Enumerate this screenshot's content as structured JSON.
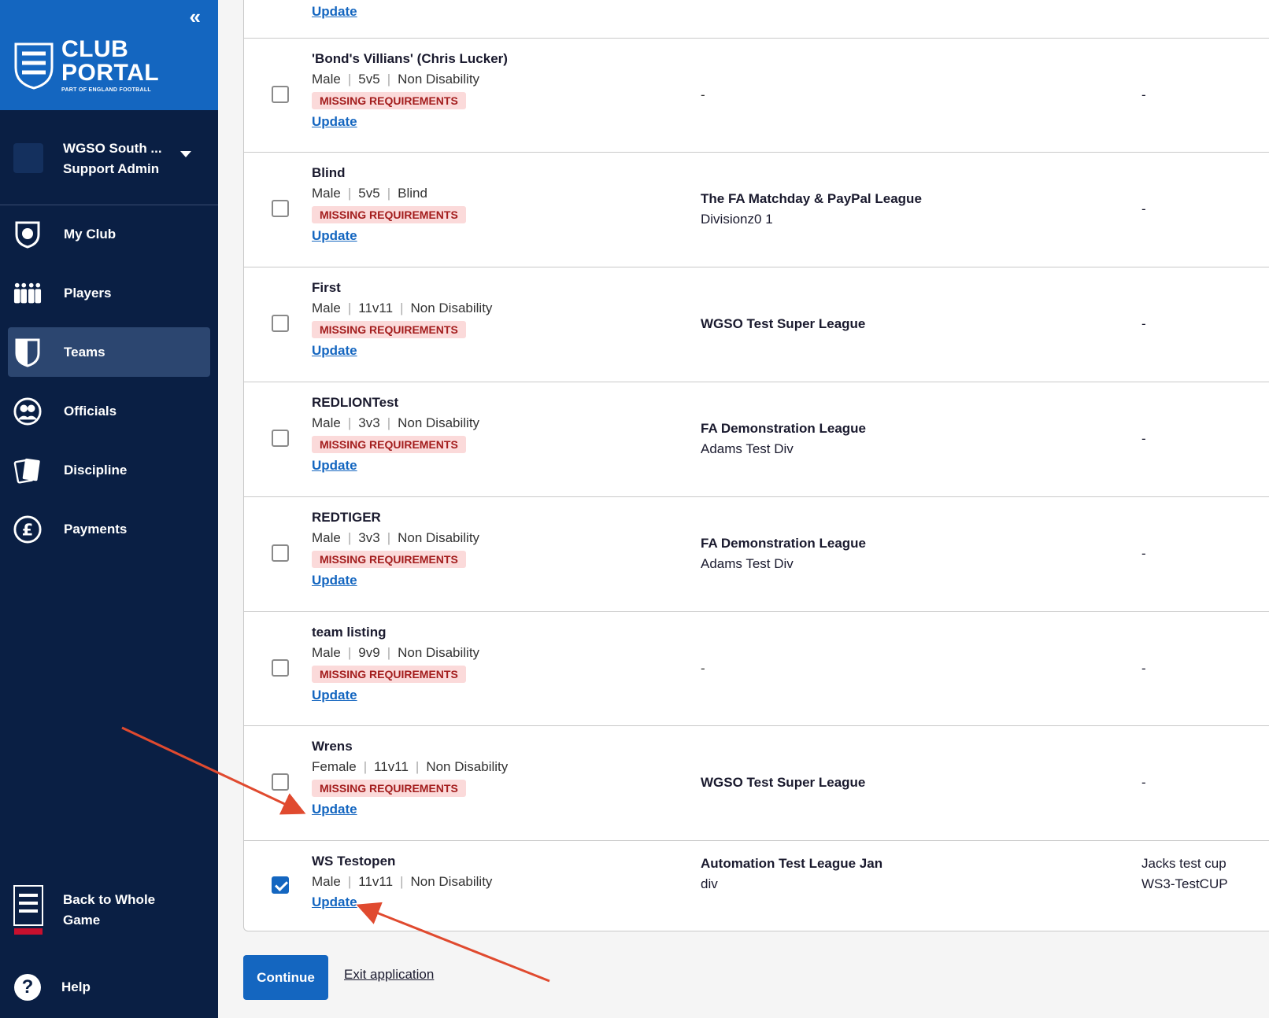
{
  "sidebar": {
    "collapse_icon": "chevron-double-left-icon",
    "brand": {
      "line1": "CLUB",
      "line2": "PORTAL",
      "tagline": "PART OF ENGLAND FOOTBALL"
    },
    "account": {
      "name": "WGSO South ...",
      "role": "Support Admin"
    },
    "nav": [
      {
        "label": "My Club",
        "icon": "shield-football-icon",
        "active": false
      },
      {
        "label": "Players",
        "icon": "players-icon",
        "active": false
      },
      {
        "label": "Teams",
        "icon": "team-shield-icon",
        "active": true
      },
      {
        "label": "Officials",
        "icon": "officials-icon",
        "active": false
      },
      {
        "label": "Discipline",
        "icon": "cards-icon",
        "active": false
      },
      {
        "label": "Payments",
        "icon": "pound-icon",
        "active": false
      }
    ],
    "back_label_1": "Back to Whole",
    "back_label_2": "Game",
    "help_label": "Help"
  },
  "teams": [
    {
      "name": "",
      "meta": [],
      "missing": false,
      "update": "Update",
      "league": "",
      "division": "",
      "cup": "",
      "cup2": "",
      "checked": false
    },
    {
      "name": "'Bond's Villians' (Chris Lucker)",
      "meta": [
        "Male",
        "5v5",
        "Non Disability"
      ],
      "missing": true,
      "update": "Update",
      "league": "-",
      "division": "",
      "cup": "-",
      "checked": false
    },
    {
      "name": "Blind",
      "meta": [
        "Male",
        "5v5",
        "Blind"
      ],
      "missing": true,
      "update": "Update",
      "league": "The FA Matchday & PayPal League",
      "division": "Divisionz0 1",
      "cup": "-",
      "checked": false
    },
    {
      "name": "First",
      "meta": [
        "Male",
        "11v11",
        "Non Disability"
      ],
      "missing": true,
      "update": "Update",
      "league": "WGSO Test Super League",
      "division": "",
      "cup": "-",
      "checked": false
    },
    {
      "name": "REDLIONTest",
      "meta": [
        "Male",
        "3v3",
        "Non Disability"
      ],
      "missing": true,
      "update": "Update",
      "league": "FA Demonstration League",
      "division": "Adams Test Div",
      "cup": "-",
      "checked": false
    },
    {
      "name": "REDTIGER",
      "meta": [
        "Male",
        "3v3",
        "Non Disability"
      ],
      "missing": true,
      "update": "Update",
      "league": "FA Demonstration League",
      "division": "Adams Test Div",
      "cup": "-",
      "checked": false
    },
    {
      "name": "team listing",
      "meta": [
        "Male",
        "9v9",
        "Non Disability"
      ],
      "missing": true,
      "update": "Update",
      "league": "-",
      "division": "",
      "cup": "-",
      "checked": false
    },
    {
      "name": "Wrens",
      "meta": [
        "Female",
        "11v11",
        "Non Disability"
      ],
      "missing": true,
      "update": "Update",
      "league": "WGSO Test Super League",
      "division": "",
      "cup": "-",
      "checked": false
    },
    {
      "name": "WS Testopen",
      "meta": [
        "Male",
        "11v11",
        "Non Disability"
      ],
      "missing": false,
      "update": "Update",
      "league": "Automation Test League Jan",
      "division": "div",
      "cup": "Jacks test cup",
      "cup2": "WS3-TestCUP",
      "checked": true
    }
  ],
  "missing_badge": "MISSING REQUIREMENTS",
  "actions": {
    "continue": "Continue",
    "exit": "Exit application"
  },
  "annotation_color": "#e04a2f"
}
